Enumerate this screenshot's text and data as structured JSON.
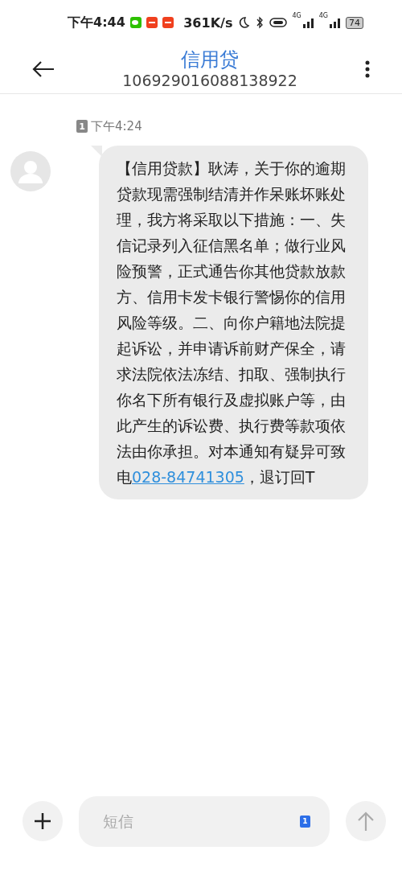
{
  "status_bar": {
    "time": "下午4:44",
    "speed": "361K/s",
    "network_1": "4G",
    "network_2": "4G",
    "battery": "74"
  },
  "header": {
    "title": "信用贷",
    "number": "106929016088138922"
  },
  "messages": [
    {
      "sim_slot": "1",
      "time": "下午4:24",
      "text_before": "【信用贷款】耿涛，关于你的逾期贷款现需强制结清并作呆账坏账处理，我方将采取以下措施：一、失信记录列入征信黑名单；做行业风险预警，正式通告你其他贷款放款方、信用卡发卡银行警惕你的信用风险等级。二、向你户籍地法院提起诉讼，并申请诉前财产保全，请求法院依法冻结、扣取、强制执行你名下所有银行及虚拟账户等，由此产生的诉讼费、执行费等款项依法由你承担。对本通知有疑异可致电",
      "link": "028-84741305",
      "text_after": "，退订回T"
    }
  ],
  "composer": {
    "placeholder": "短信",
    "sim_slot": "1"
  }
}
